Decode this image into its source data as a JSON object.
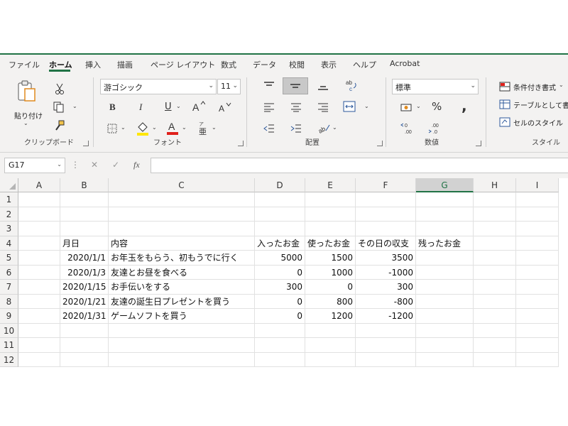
{
  "tabs": [
    "ファイル",
    "ホーム",
    "挿入",
    "描画",
    "ページ レイアウト",
    "数式",
    "データ",
    "校閲",
    "表示",
    "ヘルプ",
    "Acrobat"
  ],
  "active_tab": "ホーム",
  "ribbon": {
    "clipboard": {
      "label": "クリップボード",
      "paste_label": "貼り付け"
    },
    "font": {
      "label": "フォント",
      "font_name": "游ゴシック",
      "font_size": "11",
      "bold": "B",
      "italic": "I",
      "underline": "U"
    },
    "alignment": {
      "label": "配置"
    },
    "number": {
      "label": "数値",
      "format": "標準",
      "percent": "%",
      "comma": ","
    },
    "styles": {
      "label": "スタイル",
      "conditional": "条件付き書式",
      "as_table": "テーブルとして書式",
      "cell_styles": "セルのスタイル"
    }
  },
  "formula_bar": {
    "name_box": "G17",
    "cancel": "✕",
    "enter": "✓",
    "fx": "fx",
    "value": ""
  },
  "columns": [
    "A",
    "B",
    "C",
    "D",
    "E",
    "F",
    "G",
    "H",
    "I"
  ],
  "selected_column": "G",
  "rows": [
    "1",
    "2",
    "3",
    "4",
    "5",
    "6",
    "7",
    "8",
    "9",
    "10",
    "11",
    "12"
  ],
  "table": {
    "headers": [
      "月日",
      "内容",
      "入ったお金",
      "使ったお金",
      "その日の収支",
      "残ったお金"
    ],
    "records": [
      [
        "2020/1/1",
        "お年玉をもらう、初もうでに行く",
        "5000",
        "1500",
        "3500"
      ],
      [
        "2020/1/3",
        "友達とお昼を食べる",
        "0",
        "1000",
        "-1000"
      ],
      [
        "2020/1/15",
        "お手伝いをする",
        "300",
        "0",
        "300"
      ],
      [
        "2020/1/21",
        "友達の誕生日プレゼントを買う",
        "0",
        "800",
        "-800"
      ],
      [
        "2020/1/31",
        "ゲームソフトを買う",
        "0",
        "1200",
        "-1200"
      ]
    ]
  },
  "colors": {
    "accent": "#217346",
    "ribbon_bg": "#f3f2f1",
    "font_color": "#e0201b",
    "highlight": "#ffe600"
  }
}
